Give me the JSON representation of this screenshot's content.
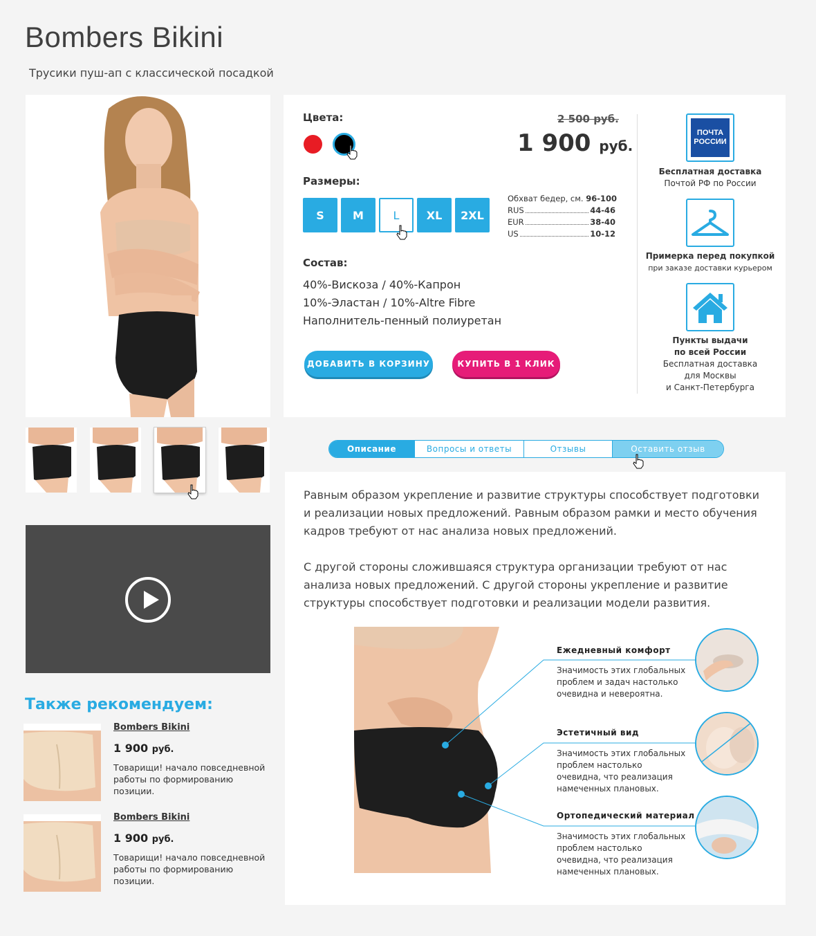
{
  "header": {
    "title": "Bombers Bikini",
    "subtitle": "Трусики пуш-ап с классической посадкой"
  },
  "product": {
    "colors_label": "Цвета:",
    "colors": [
      {
        "name": "red",
        "hex": "#e81c24"
      },
      {
        "name": "black",
        "hex": "#000000",
        "selected": true
      }
    ],
    "sizes_label": "Размеры:",
    "sizes": [
      "S",
      "M",
      "L",
      "XL",
      "2XL"
    ],
    "selected_size": "L",
    "size_table": [
      {
        "key": "Обхват бедер, см.",
        "value": "96-100"
      },
      {
        "key": "RUS",
        "value": "44-46"
      },
      {
        "key": "EUR",
        "value": "38-40"
      },
      {
        "key": "US",
        "value": "10-12"
      }
    ],
    "composition_label": "Состав:",
    "composition": [
      "40%-Вискоза / 40%-Капрон",
      "10%-Эластан / 10%-Altre Fibre",
      "Наполнитель-пенный полиуретан"
    ],
    "old_price": "2 500 руб.",
    "price": "1 900",
    "currency": "руб.",
    "add_to_cart": "ДОБАВИТЬ В КОРЗИНУ",
    "buy_one_click": "КУПИТЬ В 1 КЛИК"
  },
  "services": [
    {
      "icon": "russian-post-icon",
      "title": "Бесплатная доставка",
      "text": "Почтой РФ по России",
      "logo_lines": [
        "ПОЧТА",
        "РОССИИ"
      ]
    },
    {
      "icon": "hanger-icon",
      "title": "Примерка перед покупкой",
      "text": "при заказе доставки курьером"
    },
    {
      "icon": "house-icon",
      "title_lines": [
        "Пункты выдачи",
        "по всей России"
      ],
      "text_lines": [
        "Бесплатная доставка",
        "для Москвы",
        "и Санкт-Петербурга"
      ]
    }
  ],
  "tabs": [
    {
      "label": "Описание",
      "active": true
    },
    {
      "label": "Вопросы и ответы"
    },
    {
      "label": "Отзывы"
    },
    {
      "label": "Оставить отзыв"
    }
  ],
  "description": {
    "paragraphs": [
      "Равным образом укрепление и развитие структуры способствует подготовки и реализации новых предложений. Равным образом рамки и место обучения кадров требуют от нас анализа новых предложений.",
      "С другой стороны сложившаяся структура организации требуют от нас анализа новых предложений. С другой стороны укрепление и развитие структуры способствует подготовки и реализации модели развития."
    ],
    "features": [
      {
        "title": "Ежедневный комфорт",
        "text": "Значимость этих глобальных проблем и задач настолько очевидна и невероятна."
      },
      {
        "title": "Эстетичный вид",
        "text": "Значимость этих глобальных проблем настолько очевидна, что реализация намеченных плановых."
      },
      {
        "title": "Ортопедический материал",
        "text": "Значимость этих глобальных проблем настолько очевидна, что реализация намеченных плановых."
      }
    ]
  },
  "recommend": {
    "title": "Также рекомендуем:",
    "items": [
      {
        "name": "Bombers Bikini",
        "price": "1 900",
        "currency": "руб.",
        "text": "Товарищи! начало повседневной работы по формированию позиции."
      },
      {
        "name": "Bombers Bikini",
        "price": "1 900",
        "currency": "руб.",
        "text": "Товарищи! начало повседневной работы по формированию позиции."
      }
    ]
  },
  "colors": {
    "accent": "#29abe2",
    "pink": "#e61c78",
    "video_bg": "#4a4a4a"
  }
}
